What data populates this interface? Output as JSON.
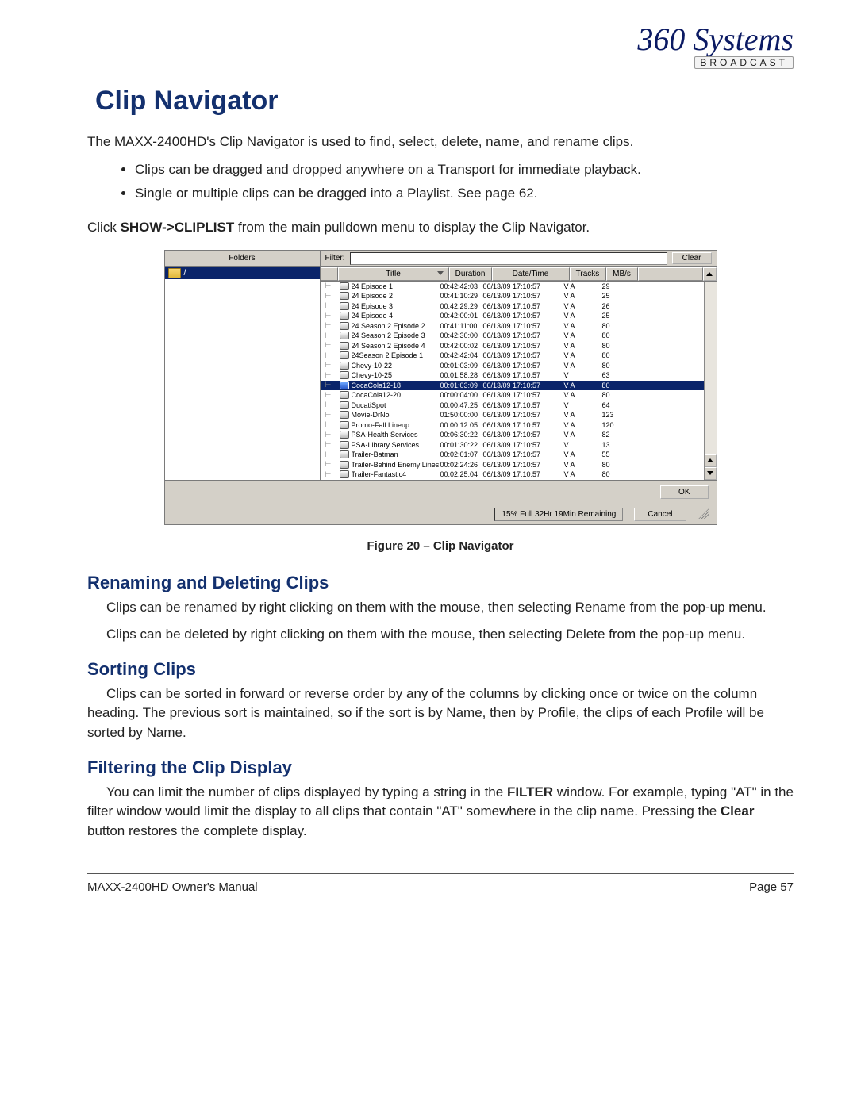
{
  "logo": {
    "script": "360 Systems",
    "tag": "BROADCAST"
  },
  "title": "Clip Navigator",
  "intro": "The MAXX-2400HD's Clip Navigator is used to find, select, delete, name, and rename clips.",
  "bullets": [
    "Clips can be dragged and dropped anywhere on a Transport for immediate playback.",
    "Single or multiple clips can be dragged into a Playlist.  See page 62."
  ],
  "show_line_pre": "Click ",
  "show_line_bold": "SHOW->CLIPLIST",
  "show_line_post": " from the main pulldown menu to display the Clip Navigator.",
  "caption": "Figure 20 – Clip Navigator",
  "sections": {
    "rename_head": "Renaming and Deleting Clips",
    "rename_p1": "Clips can be renamed by right clicking on them with the mouse, then selecting Rename from the pop-up menu.",
    "rename_p2": "Clips can be deleted by right clicking on them with the mouse, then selecting Delete from the pop-up menu.",
    "sort_head": "Sorting Clips",
    "sort_p": "Clips can be sorted in forward or reverse order by any of the columns by clicking once or twice on the column heading. The previous sort is maintained, so if the sort is by Name, then by Profile, the clips of each Profile will be sorted by Name.",
    "filter_head": "Filtering the Clip Display",
    "filter_p_1": "You can limit the number of clips displayed by typing a string in the ",
    "filter_p_bold1": "FILTER",
    "filter_p_2": " window. For example, typing \"AT\" in the filter window would limit the display to all clips that contain \"AT\" somewhere in the clip name. Pressing the ",
    "filter_p_bold2": "Clear",
    "filter_p_3": " button restores the complete display."
  },
  "footer": {
    "left": "MAXX-2400HD Owner's Manual",
    "right": "Page 57"
  },
  "app": {
    "folders_label": "Folders",
    "filter_label": "Filter:",
    "clear_btn": "Clear",
    "ok_btn": "OK",
    "cancel_btn": "Cancel",
    "status": "15% Full  32Hr 19Min Remaining",
    "root_folder": "/",
    "columns": {
      "title": "Title",
      "duration": "Duration",
      "datetime": "Date/Time",
      "tracks": "Tracks",
      "mbs": "MB/s"
    },
    "selected_index": 10,
    "clips": [
      {
        "title": "24 Episode 1",
        "duration": "00:42:42:03",
        "dt": "06/13/09 17:10:57",
        "tracks": "V A",
        "mbs": "29"
      },
      {
        "title": "24 Episode 2",
        "duration": "00:41:10:29",
        "dt": "06/13/09 17:10:57",
        "tracks": "V A",
        "mbs": "25"
      },
      {
        "title": "24 Episode 3",
        "duration": "00:42:29:29",
        "dt": "06/13/09 17:10:57",
        "tracks": "V A",
        "mbs": "26"
      },
      {
        "title": "24 Episode 4",
        "duration": "00:42:00:01",
        "dt": "06/13/09 17:10:57",
        "tracks": "V A",
        "mbs": "25"
      },
      {
        "title": "24 Season 2 Episode 2",
        "duration": "00:41:11:00",
        "dt": "06/13/09 17:10:57",
        "tracks": "V A",
        "mbs": "80"
      },
      {
        "title": "24 Season 2 Episode 3",
        "duration": "00:42:30:00",
        "dt": "06/13/09 17:10:57",
        "tracks": "V A",
        "mbs": "80"
      },
      {
        "title": "24 Season 2 Episode 4",
        "duration": "00:42:00:02",
        "dt": "06/13/09 17:10:57",
        "tracks": "V A",
        "mbs": "80"
      },
      {
        "title": "24Season 2 Episode 1",
        "duration": "00:42:42:04",
        "dt": "06/13/09 17:10:57",
        "tracks": "V A",
        "mbs": "80"
      },
      {
        "title": "Chevy-10-22",
        "duration": "00:01:03:09",
        "dt": "06/13/09 17:10:57",
        "tracks": "V A",
        "mbs": "80"
      },
      {
        "title": "Chevy-10-25",
        "duration": "00:01:58:28",
        "dt": "06/13/09 17:10:57",
        "tracks": "V",
        "mbs": "63"
      },
      {
        "title": "CocaCola12-18",
        "duration": "00:01:03:09",
        "dt": "06/13/09 17:10:57",
        "tracks": "V A",
        "mbs": "80"
      },
      {
        "title": "CocaCola12-20",
        "duration": "00:00:04:00",
        "dt": "06/13/09 17:10:57",
        "tracks": "V A",
        "mbs": "80"
      },
      {
        "title": "DucatiSpot",
        "duration": "00:00:47:25",
        "dt": "06/13/09 17:10:57",
        "tracks": "V",
        "mbs": "64"
      },
      {
        "title": "Movie-DrNo",
        "duration": "01:50:00:00",
        "dt": "06/13/09 17:10:57",
        "tracks": "V A",
        "mbs": "123"
      },
      {
        "title": "Promo-Fall Lineup",
        "duration": "00:00:12:05",
        "dt": "06/13/09 17:10:57",
        "tracks": "V A",
        "mbs": "120"
      },
      {
        "title": "PSA-Health Services",
        "duration": "00:06:30:22",
        "dt": "06/13/09 17:10:57",
        "tracks": "V A",
        "mbs": "82"
      },
      {
        "title": "PSA-Library Services",
        "duration": "00:01:30:22",
        "dt": "06/13/09 17:10:57",
        "tracks": "V",
        "mbs": "13"
      },
      {
        "title": "Trailer-Batman",
        "duration": "00:02:01:07",
        "dt": "06/13/09 17:10:57",
        "tracks": "V A",
        "mbs": "55"
      },
      {
        "title": "Trailer-Behind Enemy Lines",
        "duration": "00:02:24:26",
        "dt": "06/13/09 17:10:57",
        "tracks": "V A",
        "mbs": "80"
      },
      {
        "title": "Trailer-Fantastic4",
        "duration": "00:02:25:04",
        "dt": "06/13/09 17:10:57",
        "tracks": "V A",
        "mbs": "80"
      }
    ]
  }
}
